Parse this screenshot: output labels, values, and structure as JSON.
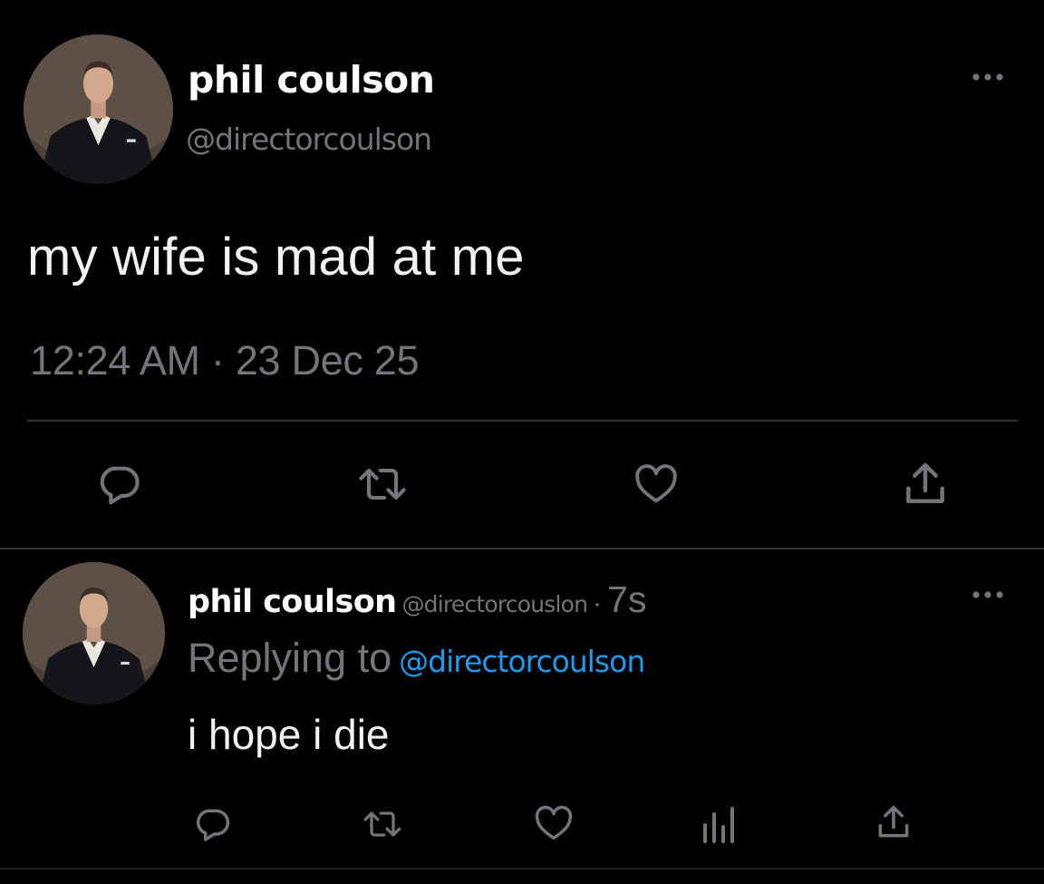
{
  "main_tweet": {
    "display_name": "phil coulson",
    "handle": "@directorcoulson",
    "text": "my wife is mad at me",
    "timestamp": "12:24 AM · 23 Dec 25",
    "more_icon": "ellipsis-icon",
    "actions": [
      "reply-icon",
      "retweet-icon",
      "like-icon",
      "share-icon"
    ]
  },
  "reply_tweet": {
    "display_name": "phil coulson",
    "handle": "@directorcouslon",
    "separator": "·",
    "age": "7s",
    "replying_to_label": "Replying to",
    "replying_to_handle": "@directorcoulson",
    "text": "i hope i die",
    "more_icon": "ellipsis-icon",
    "actions": [
      "reply-icon",
      "retweet-icon",
      "like-icon",
      "views-icon",
      "share-icon"
    ]
  },
  "colors": {
    "background": "#000000",
    "primary_text": "#e7e9ea",
    "secondary_text": "#71767b",
    "link": "#1d9bf0",
    "divider": "#2f3336"
  }
}
